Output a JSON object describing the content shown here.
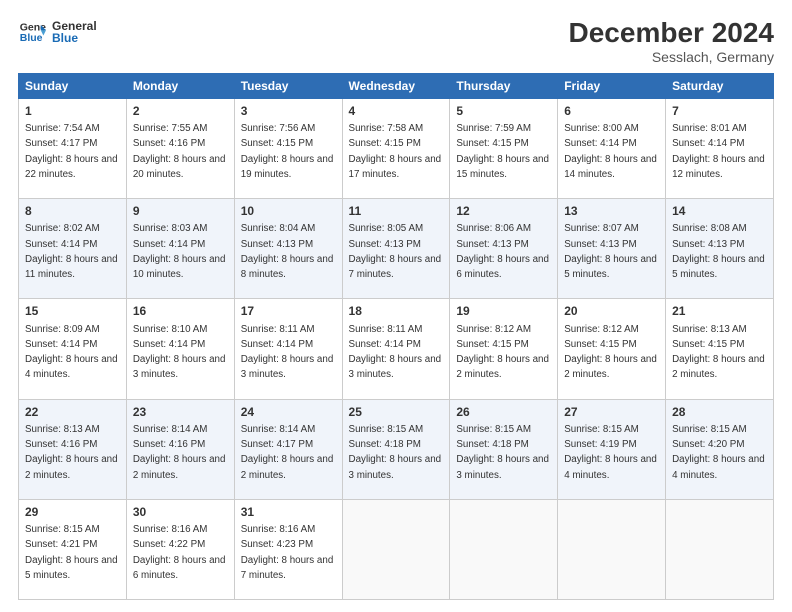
{
  "header": {
    "logo_line1": "General",
    "logo_line2": "Blue",
    "main_title": "December 2024",
    "subtitle": "Sesslach, Germany"
  },
  "weekdays": [
    "Sunday",
    "Monday",
    "Tuesday",
    "Wednesday",
    "Thursday",
    "Friday",
    "Saturday"
  ],
  "weeks": [
    [
      {
        "day": "1",
        "sunrise": "Sunrise: 7:54 AM",
        "sunset": "Sunset: 4:17 PM",
        "daylight": "Daylight: 8 hours and 22 minutes."
      },
      {
        "day": "2",
        "sunrise": "Sunrise: 7:55 AM",
        "sunset": "Sunset: 4:16 PM",
        "daylight": "Daylight: 8 hours and 20 minutes."
      },
      {
        "day": "3",
        "sunrise": "Sunrise: 7:56 AM",
        "sunset": "Sunset: 4:15 PM",
        "daylight": "Daylight: 8 hours and 19 minutes."
      },
      {
        "day": "4",
        "sunrise": "Sunrise: 7:58 AM",
        "sunset": "Sunset: 4:15 PM",
        "daylight": "Daylight: 8 hours and 17 minutes."
      },
      {
        "day": "5",
        "sunrise": "Sunrise: 7:59 AM",
        "sunset": "Sunset: 4:15 PM",
        "daylight": "Daylight: 8 hours and 15 minutes."
      },
      {
        "day": "6",
        "sunrise": "Sunrise: 8:00 AM",
        "sunset": "Sunset: 4:14 PM",
        "daylight": "Daylight: 8 hours and 14 minutes."
      },
      {
        "day": "7",
        "sunrise": "Sunrise: 8:01 AM",
        "sunset": "Sunset: 4:14 PM",
        "daylight": "Daylight: 8 hours and 12 minutes."
      }
    ],
    [
      {
        "day": "8",
        "sunrise": "Sunrise: 8:02 AM",
        "sunset": "Sunset: 4:14 PM",
        "daylight": "Daylight: 8 hours and 11 minutes."
      },
      {
        "day": "9",
        "sunrise": "Sunrise: 8:03 AM",
        "sunset": "Sunset: 4:14 PM",
        "daylight": "Daylight: 8 hours and 10 minutes."
      },
      {
        "day": "10",
        "sunrise": "Sunrise: 8:04 AM",
        "sunset": "Sunset: 4:13 PM",
        "daylight": "Daylight: 8 hours and 8 minutes."
      },
      {
        "day": "11",
        "sunrise": "Sunrise: 8:05 AM",
        "sunset": "Sunset: 4:13 PM",
        "daylight": "Daylight: 8 hours and 7 minutes."
      },
      {
        "day": "12",
        "sunrise": "Sunrise: 8:06 AM",
        "sunset": "Sunset: 4:13 PM",
        "daylight": "Daylight: 8 hours and 6 minutes."
      },
      {
        "day": "13",
        "sunrise": "Sunrise: 8:07 AM",
        "sunset": "Sunset: 4:13 PM",
        "daylight": "Daylight: 8 hours and 5 minutes."
      },
      {
        "day": "14",
        "sunrise": "Sunrise: 8:08 AM",
        "sunset": "Sunset: 4:13 PM",
        "daylight": "Daylight: 8 hours and 5 minutes."
      }
    ],
    [
      {
        "day": "15",
        "sunrise": "Sunrise: 8:09 AM",
        "sunset": "Sunset: 4:14 PM",
        "daylight": "Daylight: 8 hours and 4 minutes."
      },
      {
        "day": "16",
        "sunrise": "Sunrise: 8:10 AM",
        "sunset": "Sunset: 4:14 PM",
        "daylight": "Daylight: 8 hours and 3 minutes."
      },
      {
        "day": "17",
        "sunrise": "Sunrise: 8:11 AM",
        "sunset": "Sunset: 4:14 PM",
        "daylight": "Daylight: 8 hours and 3 minutes."
      },
      {
        "day": "18",
        "sunrise": "Sunrise: 8:11 AM",
        "sunset": "Sunset: 4:14 PM",
        "daylight": "Daylight: 8 hours and 3 minutes."
      },
      {
        "day": "19",
        "sunrise": "Sunrise: 8:12 AM",
        "sunset": "Sunset: 4:15 PM",
        "daylight": "Daylight: 8 hours and 2 minutes."
      },
      {
        "day": "20",
        "sunrise": "Sunrise: 8:12 AM",
        "sunset": "Sunset: 4:15 PM",
        "daylight": "Daylight: 8 hours and 2 minutes."
      },
      {
        "day": "21",
        "sunrise": "Sunrise: 8:13 AM",
        "sunset": "Sunset: 4:15 PM",
        "daylight": "Daylight: 8 hours and 2 minutes."
      }
    ],
    [
      {
        "day": "22",
        "sunrise": "Sunrise: 8:13 AM",
        "sunset": "Sunset: 4:16 PM",
        "daylight": "Daylight: 8 hours and 2 minutes."
      },
      {
        "day": "23",
        "sunrise": "Sunrise: 8:14 AM",
        "sunset": "Sunset: 4:16 PM",
        "daylight": "Daylight: 8 hours and 2 minutes."
      },
      {
        "day": "24",
        "sunrise": "Sunrise: 8:14 AM",
        "sunset": "Sunset: 4:17 PM",
        "daylight": "Daylight: 8 hours and 2 minutes."
      },
      {
        "day": "25",
        "sunrise": "Sunrise: 8:15 AM",
        "sunset": "Sunset: 4:18 PM",
        "daylight": "Daylight: 8 hours and 3 minutes."
      },
      {
        "day": "26",
        "sunrise": "Sunrise: 8:15 AM",
        "sunset": "Sunset: 4:18 PM",
        "daylight": "Daylight: 8 hours and 3 minutes."
      },
      {
        "day": "27",
        "sunrise": "Sunrise: 8:15 AM",
        "sunset": "Sunset: 4:19 PM",
        "daylight": "Daylight: 8 hours and 4 minutes."
      },
      {
        "day": "28",
        "sunrise": "Sunrise: 8:15 AM",
        "sunset": "Sunset: 4:20 PM",
        "daylight": "Daylight: 8 hours and 4 minutes."
      }
    ],
    [
      {
        "day": "29",
        "sunrise": "Sunrise: 8:15 AM",
        "sunset": "Sunset: 4:21 PM",
        "daylight": "Daylight: 8 hours and 5 minutes."
      },
      {
        "day": "30",
        "sunrise": "Sunrise: 8:16 AM",
        "sunset": "Sunset: 4:22 PM",
        "daylight": "Daylight: 8 hours and 6 minutes."
      },
      {
        "day": "31",
        "sunrise": "Sunrise: 8:16 AM",
        "sunset": "Sunset: 4:23 PM",
        "daylight": "Daylight: 8 hours and 7 minutes."
      },
      null,
      null,
      null,
      null
    ]
  ]
}
